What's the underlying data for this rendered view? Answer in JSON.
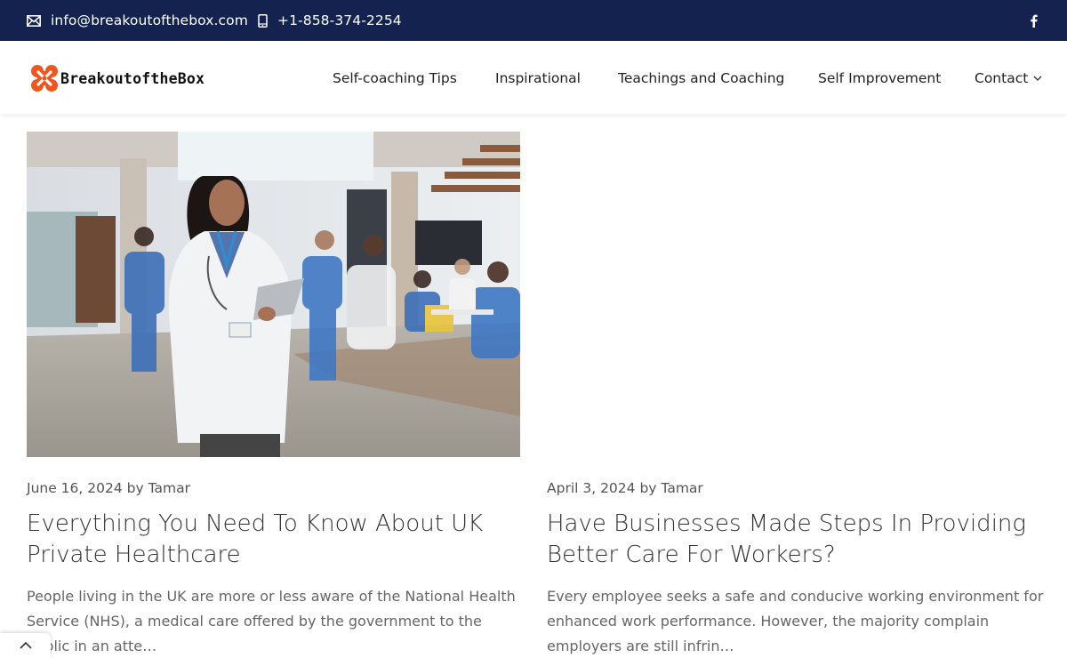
{
  "topbar": {
    "email": "info@breakoutofthebox.com",
    "phone": "+1-858-374-2254",
    "icons": {
      "email": "envelope-icon",
      "phone": "mobile-phone-icon",
      "social": "facebook-icon"
    }
  },
  "header": {
    "logo_text": "BreakoutoftheBox",
    "logo_icon": "puzzle-cross-icon",
    "nav": {
      "self_coaching": "Self-coaching Tips",
      "inspirational": "Inspirational",
      "teachings": "Teachings and Coaching",
      "self_improvement": "Self Improvement",
      "contact": "Contact"
    }
  },
  "posts": [
    {
      "date": "June 16, 2024",
      "by": "by",
      "author": "Tamar",
      "title": "Everything You Need To Know About UK Private Healthcare",
      "excerpt": "People living in the UK are more or less aware of the National Health Service (NHS), a medical care offered by the government to the public in an atte…",
      "image": "doctor-in-hospital-photo"
    },
    {
      "date": "April 3, 2024",
      "by": "by",
      "author": "Tamar",
      "title": "Have Businesses Made Steps In Providing Better Care For Workers?",
      "excerpt": "Every employee seeks a safe and conducive working environment for enhanced work performance. However, the majority complain employers are still infrin…",
      "image": "blank-image"
    }
  ],
  "colors": {
    "topbar_bg": "#13224f",
    "logo_orange": "#f0561e",
    "text_dark": "#333333",
    "text_muted": "#666666"
  }
}
